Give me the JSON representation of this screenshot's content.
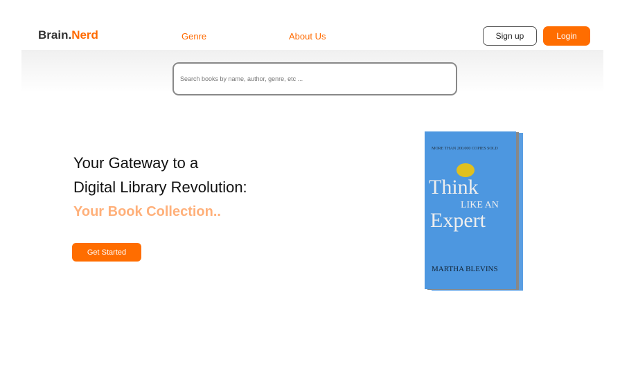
{
  "header": {
    "logo_a": "Brain.",
    "logo_b": "Nerd",
    "nav": [
      "Genre",
      "About Us"
    ],
    "signup": "Sign up",
    "login": "Login"
  },
  "search": {
    "placeholder": "Search books by name, author, genre, etc ..."
  },
  "hero": {
    "line1": "Your Gateway to a",
    "line2": "Digital Library Revolution:",
    "line3": "Your Book Collection..",
    "cta": "Get Started"
  },
  "book": {
    "tagline": "MORE THAN 200.000 COPIES SOLD",
    "t1": "Think",
    "t2": "LIKE AN",
    "t3": "Expert",
    "author": "MARTHA BLEVINS"
  },
  "colors": {
    "accent": "#ff6d00",
    "book": "#4d97e0"
  }
}
